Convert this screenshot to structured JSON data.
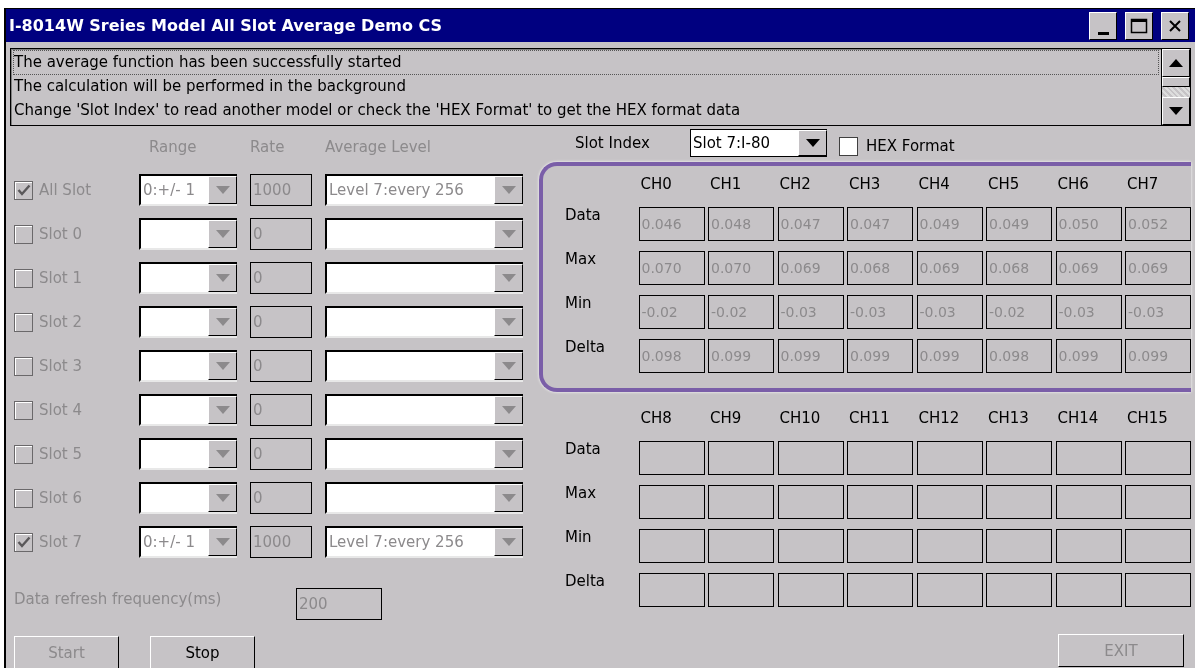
{
  "window": {
    "title": "I-8014W Sreies Model All Slot Average  Demo CS"
  },
  "log": {
    "lines": [
      {
        "text": "The average function has been successfully started",
        "selected": true
      },
      {
        "text": "The calculation will be performed in the background",
        "selected": false
      },
      {
        "text": "Change 'Slot Index' to read another model or check the 'HEX Format' to get the HEX format data",
        "selected": false
      }
    ]
  },
  "settings": {
    "disabled": true,
    "headers": [
      "Range",
      "Rate",
      "Average Level"
    ],
    "rows": [
      {
        "label": "All Slot",
        "checked": true,
        "range": "0:+/- 1",
        "rate": "1000",
        "level": "Level 7:every 256"
      },
      {
        "label": "Slot 0",
        "checked": false,
        "rate": "0"
      },
      {
        "label": "Slot 1",
        "checked": false,
        "rate": "0"
      },
      {
        "label": "Slot 2",
        "checked": false,
        "rate": "0"
      },
      {
        "label": "Slot 3",
        "checked": false,
        "rate": "0"
      },
      {
        "label": "Slot 4",
        "checked": false,
        "rate": "0"
      },
      {
        "label": "Slot 5",
        "checked": false,
        "rate": "0"
      },
      {
        "label": "Slot 6",
        "checked": false,
        "rate": "0"
      },
      {
        "label": "Slot 7",
        "checked": true,
        "range": "0:+/- 1",
        "rate": "1000",
        "level": "Level 7:every 256"
      }
    ],
    "refresh": {
      "label": "Data refresh frequency(ms)",
      "value": "200"
    }
  },
  "slot_index": {
    "label": "Slot Index",
    "value": "Slot 7:I-80"
  },
  "hex_format": {
    "label": "HEX Format",
    "checked": false
  },
  "groups": [
    {
      "highlighted": true,
      "channels": [
        "CH0",
        "CH1",
        "CH2",
        "CH3",
        "CH4",
        "CH5",
        "CH6",
        "CH7"
      ],
      "rows": [
        {
          "label": "Data",
          "values": [
            "0.046",
            "0.048",
            "0.047",
            "0.047",
            "0.049",
            "0.049",
            "0.050",
            "0.052"
          ]
        },
        {
          "label": "Max",
          "values": [
            "0.070",
            "0.070",
            "0.069",
            "0.068",
            "0.069",
            "0.068",
            "0.069",
            "0.069"
          ]
        },
        {
          "label": "Min",
          "values": [
            "-0.02",
            "-0.02",
            "-0.03",
            "-0.03",
            "-0.03",
            "-0.02",
            "-0.03",
            "-0.03"
          ]
        },
        {
          "label": "Delta",
          "values": [
            "0.098",
            "0.099",
            "0.099",
            "0.099",
            "0.099",
            "0.098",
            "0.099",
            "0.099"
          ]
        }
      ]
    },
    {
      "highlighted": false,
      "channels": [
        "CH8",
        "CH9",
        "CH10",
        "CH11",
        "CH12",
        "CH13",
        "CH14",
        "CH15"
      ],
      "rows": [
        {
          "label": "Data"
        },
        {
          "label": "Max"
        },
        {
          "label": "Min"
        },
        {
          "label": "Delta"
        }
      ]
    }
  ],
  "buttons": [
    {
      "label": "Start",
      "disabled": true
    },
    {
      "label": "Stop",
      "disabled": false
    }
  ],
  "exit_button": {
    "label": "EXIT",
    "disabled": true
  }
}
